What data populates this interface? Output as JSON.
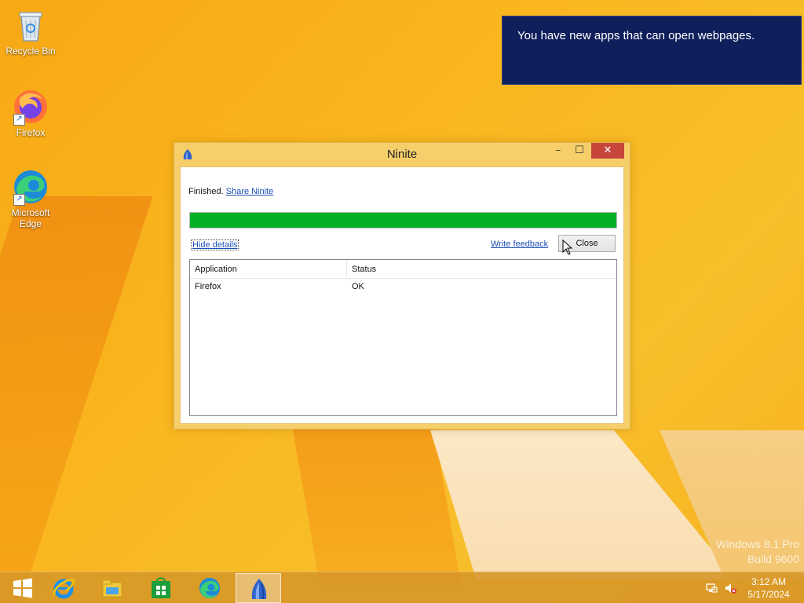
{
  "desktop": {
    "icons": [
      {
        "label": "Recycle Bin"
      },
      {
        "label": "Firefox"
      },
      {
        "label": "Microsoft Edge"
      }
    ]
  },
  "notification": {
    "message": "You have new apps that can open webpages."
  },
  "window": {
    "title": "Ninite",
    "minimize_glyph": "–",
    "maximize_glyph": "☐",
    "close_glyph": "✕",
    "status_text": "Finished.",
    "share_link": "Share Ninite",
    "progress_fraction": 1.0,
    "progress_color": "#06b025",
    "hide_details_link": "Hide details",
    "write_feedback_link": "Write feedback",
    "close_button": "Close",
    "table": {
      "columns": [
        "Application",
        "Status"
      ],
      "rows": [
        {
          "application": "Firefox",
          "status": "OK"
        }
      ]
    }
  },
  "watermark": {
    "line1": "Windows 8.1 Pro",
    "line2": "Build 9600"
  },
  "taskbar": {
    "items": [
      {
        "icon": "windows-start-icon"
      },
      {
        "icon": "internet-explorer-icon"
      },
      {
        "icon": "file-explorer-icon"
      },
      {
        "icon": "store-icon"
      },
      {
        "icon": "edge-icon"
      },
      {
        "icon": "ninite-icon"
      }
    ],
    "clock_time": "3:12 AM",
    "clock_date": "5/17/2024"
  }
}
